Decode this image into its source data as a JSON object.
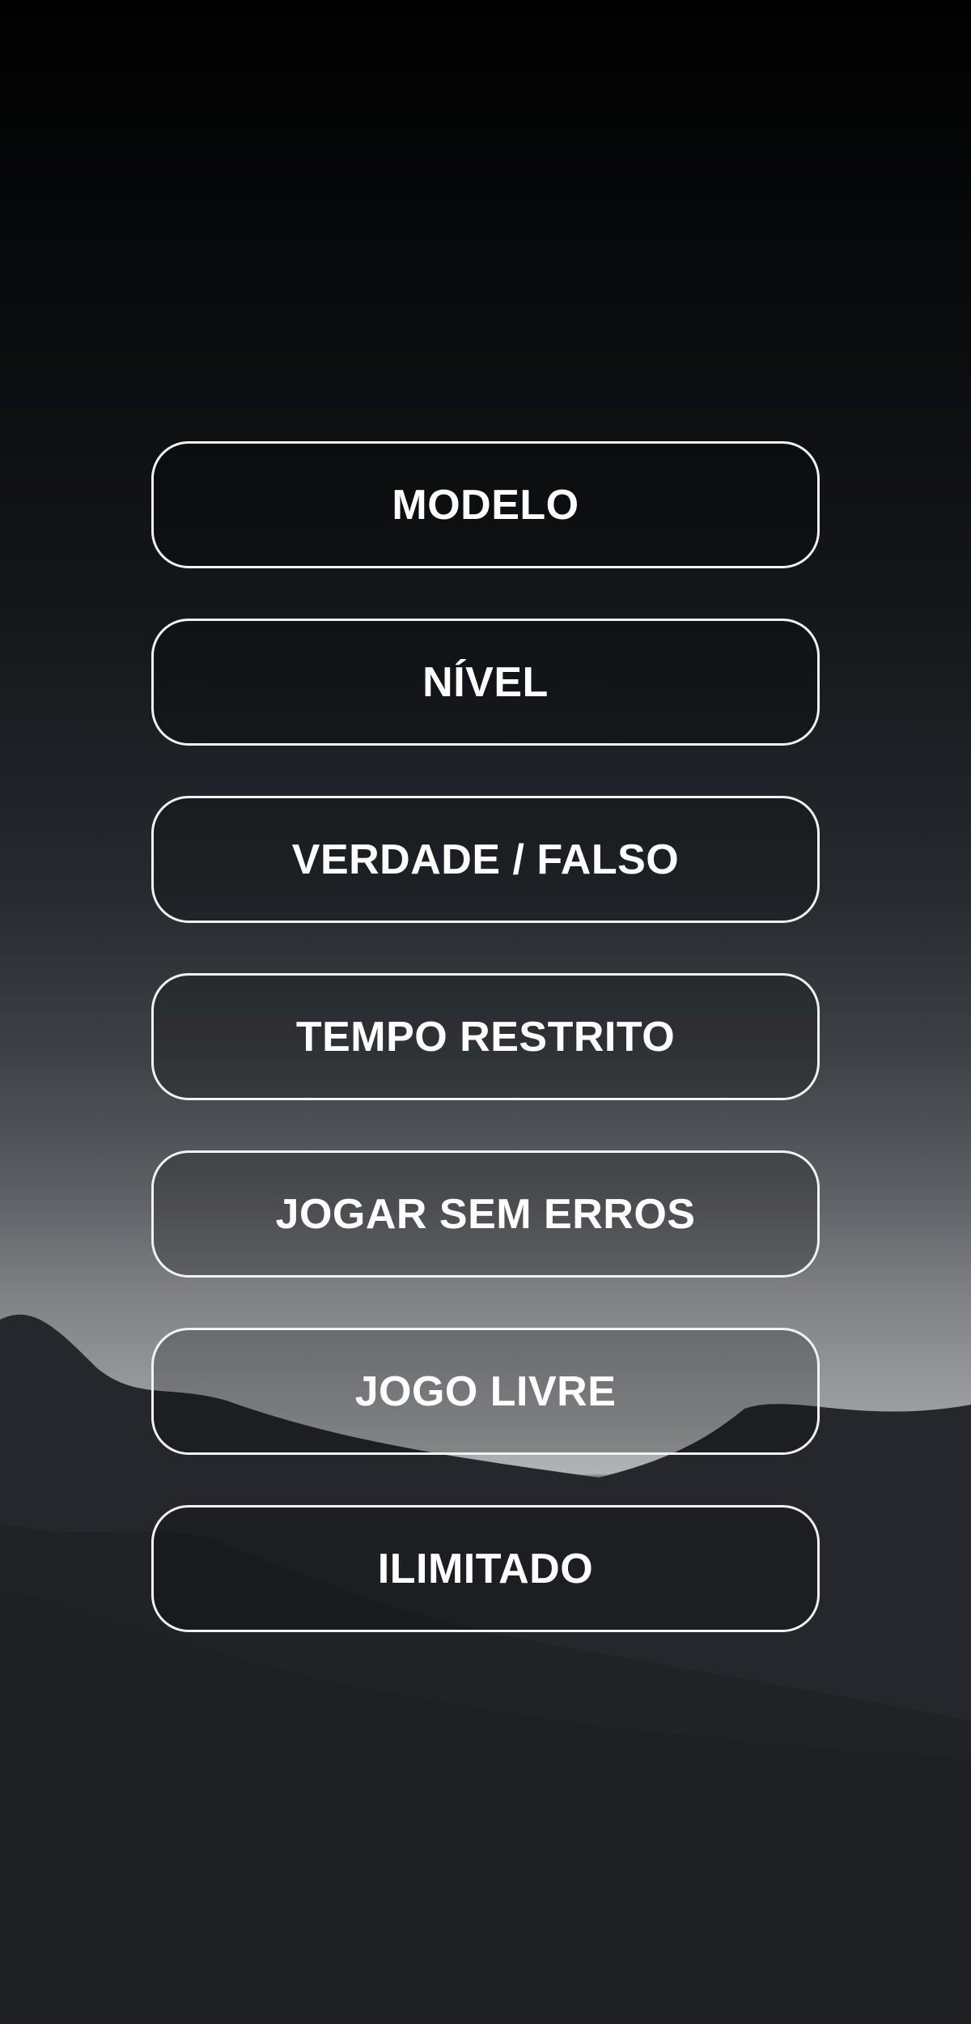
{
  "menu": {
    "items": [
      {
        "label": "MODELO"
      },
      {
        "label": "NÍVEL"
      },
      {
        "label": "VERDADE / FALSO"
      },
      {
        "label": "TEMPO RESTRITO"
      },
      {
        "label": "JOGAR SEM ERROS"
      },
      {
        "label": "JOGO LIVRE"
      },
      {
        "label": "ILIMITADO"
      }
    ]
  },
  "colors": {
    "button_border": "#f2f2f2",
    "button_text": "#ffffff",
    "background_top": "#010101",
    "background_bottom": "#1e2024",
    "horizon_glow": "#b2b3b6"
  }
}
